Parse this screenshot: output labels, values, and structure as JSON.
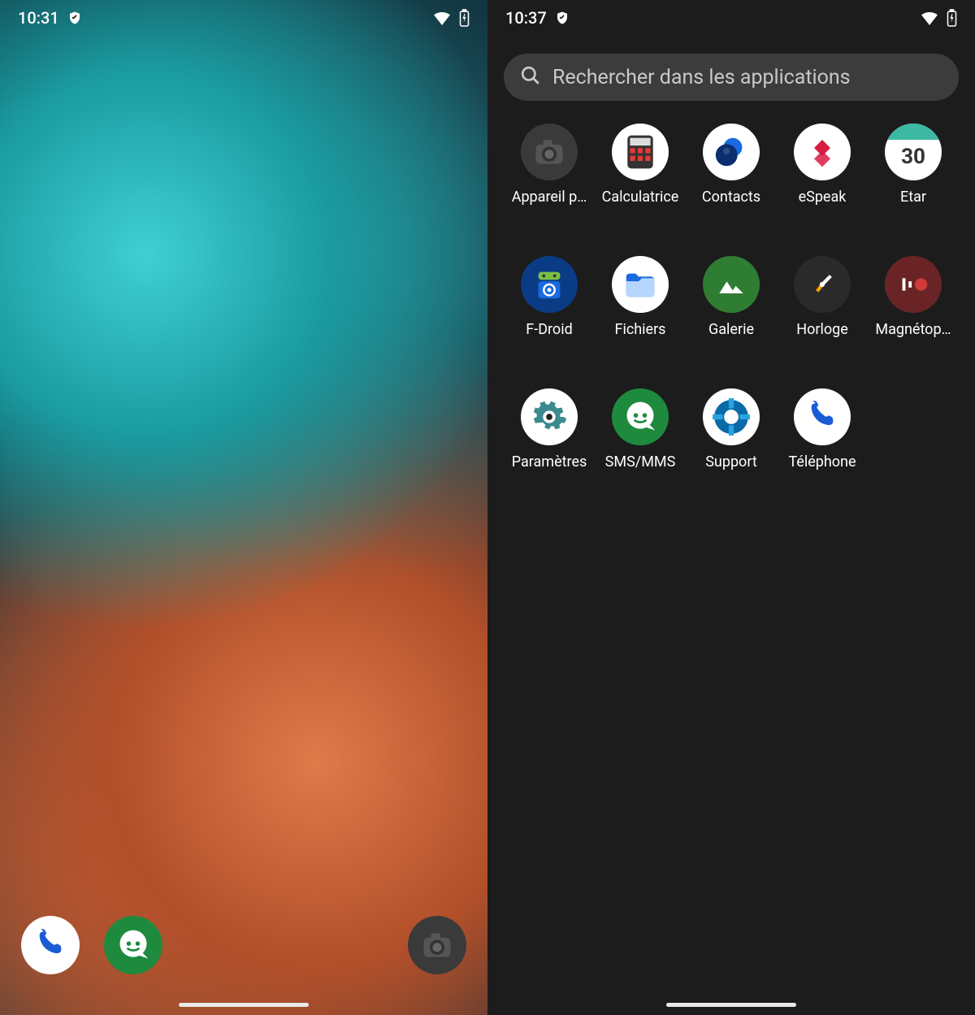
{
  "home": {
    "status": {
      "time": "10:31"
    },
    "dock": [
      {
        "name": "phone",
        "label": "Téléphone"
      },
      {
        "name": "sms",
        "label": "SMS/MMS"
      },
      {
        "name": "camera",
        "label": "Appareil photo"
      }
    ]
  },
  "drawer": {
    "status": {
      "time": "10:37"
    },
    "search": {
      "placeholder": "Rechercher dans les applications"
    },
    "calendar_date": "30",
    "apps": [
      {
        "id": "camera",
        "label": "Appareil p…"
      },
      {
        "id": "calculator",
        "label": "Calculatrice"
      },
      {
        "id": "contacts",
        "label": "Contacts"
      },
      {
        "id": "espeak",
        "label": "eSpeak"
      },
      {
        "id": "etar",
        "label": "Etar"
      },
      {
        "id": "fdroid",
        "label": "F-Droid"
      },
      {
        "id": "files",
        "label": "Fichiers"
      },
      {
        "id": "gallery",
        "label": "Galerie"
      },
      {
        "id": "clock",
        "label": "Horloge"
      },
      {
        "id": "recorder",
        "label": "Magnétop…"
      },
      {
        "id": "settings",
        "label": "Paramètres"
      },
      {
        "id": "sms",
        "label": "SMS/MMS"
      },
      {
        "id": "support",
        "label": "Support"
      },
      {
        "id": "phone",
        "label": "Téléphone"
      }
    ]
  }
}
